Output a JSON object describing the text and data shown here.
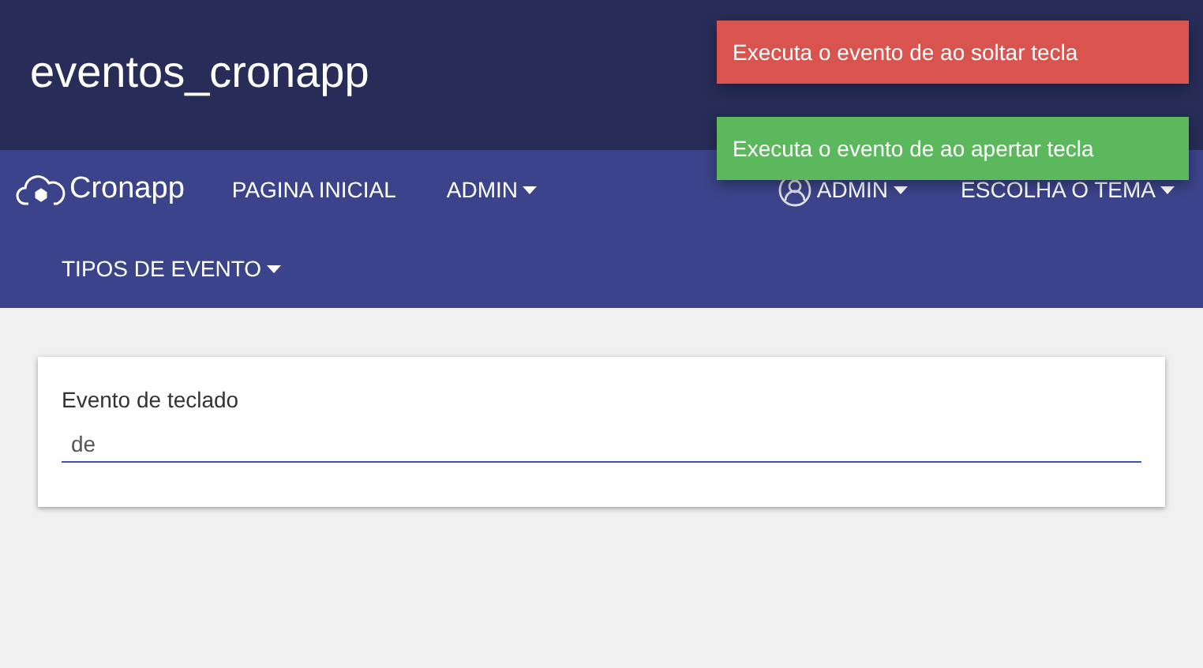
{
  "header": {
    "title": "eventos_cronapp"
  },
  "navbar": {
    "brand": "Cronapp",
    "left_items": [
      {
        "label": "PAGINA INICIAL",
        "dropdown": false
      },
      {
        "label": "ADMIN",
        "dropdown": true
      }
    ],
    "right_items": [
      {
        "label": "ADMIN",
        "dropdown": true,
        "kind": "user"
      },
      {
        "label": "ESCOLHA O TEMA",
        "dropdown": true,
        "kind": "plain"
      }
    ],
    "second_row": [
      {
        "label": "TIPOS DE EVENTO",
        "dropdown": true
      }
    ]
  },
  "form": {
    "field": {
      "label": "Evento de teclado",
      "value": "de",
      "focused": true
    }
  },
  "toasts": [
    {
      "text": "Executa o evento de ao soltar tecla",
      "kind": "error"
    },
    {
      "text": "Executa o evento de ao apertar tecla",
      "kind": "success"
    }
  ]
}
